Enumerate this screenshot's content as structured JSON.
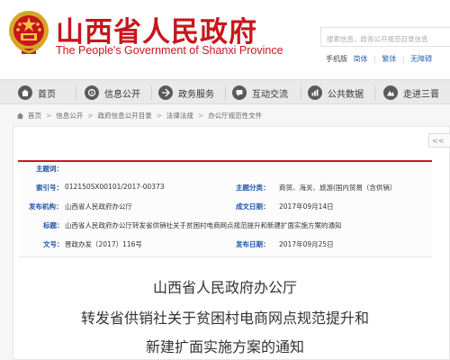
{
  "header": {
    "title_cn": "山西省人民政府",
    "title_en": "The People's Government of Shanxi Province",
    "search_placeholder": "搜索信息，政务公开规范目录信息",
    "lang": {
      "prefix": "手机版",
      "simplified": "简体",
      "sep1": "|",
      "traditional": "繁体",
      "sep2": "|",
      "accessible": "无障碍"
    },
    "emblem": "national-emblem"
  },
  "nav": [
    {
      "label": "首页",
      "icon": "home-icon"
    },
    {
      "label": "信息公开",
      "icon": "info-icon"
    },
    {
      "label": "政务服务",
      "icon": "service-icon"
    },
    {
      "label": "互动交流",
      "icon": "chat-icon"
    },
    {
      "label": "公共数据",
      "icon": "data-icon"
    },
    {
      "label": "走进三晋",
      "icon": "tour-icon"
    }
  ],
  "breadcrumb": [
    "首页",
    "信息公开",
    "政府信息公开目录",
    "法律法规",
    "办公厅规范性文件"
  ],
  "corner": "<<",
  "meta": {
    "theme_label": "主题词：",
    "theme_value": "",
    "index_label": "索引号：",
    "index_value": "012150SX00101/2017-00373",
    "topic_label": "主题分类：",
    "topic_value": "商贸、海关、旅游(国内贸易（含供销）",
    "org_label": "发布机构：",
    "org_value": "山西省人民政府办公厅",
    "created_label": "成文日期：",
    "created_value": "2017年09月14日",
    "title_label": "标题：",
    "title_value": "山西省人民政府办公厅转发省供销社关于贫困村电商网点规范提升和新建扩面实施方案的通知",
    "docno_label": "文号：",
    "docno_value": "晋政办发〔2017〕116号",
    "published_label": "发布日期：",
    "published_value": "2017年09月25日"
  },
  "document_title": [
    "山西省人民政府办公厅",
    "转发省供销社关于贫困村电商网点规范提升和",
    "新建扩面实施方案的通知"
  ],
  "colors": {
    "brand_red": "#c8161d",
    "label_blue": "#1f56a8",
    "nav_bg": "#e9e9e9"
  }
}
